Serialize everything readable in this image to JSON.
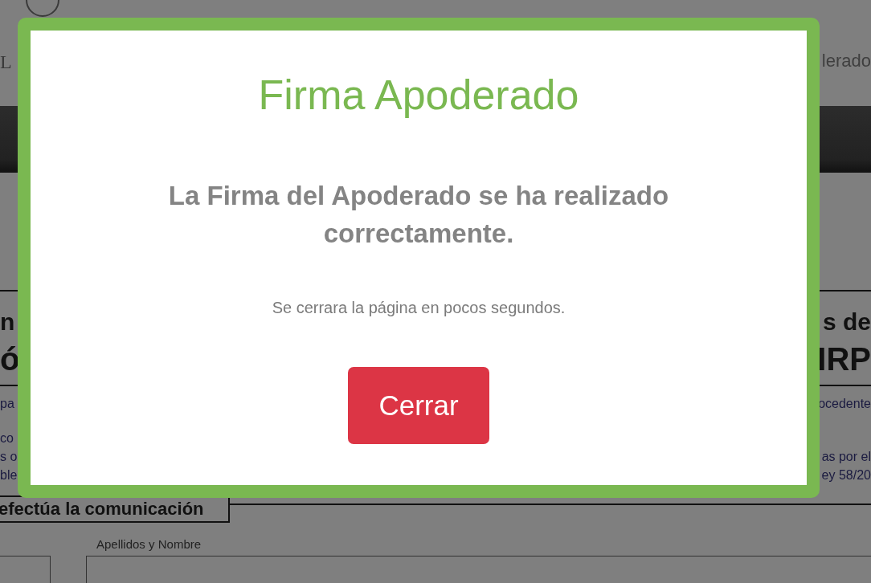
{
  "background": {
    "logo_letter": "L",
    "header_text": "lerado",
    "document_rows": [
      {
        "kind": "heading",
        "left": "n",
        "right": "s de"
      },
      {
        "kind": "title",
        "left": "ó",
        "right": "IRP"
      },
      {
        "kind": "body",
        "left": "pa",
        "right": "ocedente"
      },
      {
        "kind": "body",
        "left": "co"
      },
      {
        "kind": "body",
        "left": "s o",
        "right": "as por el"
      },
      {
        "kind": "body",
        "left": "ble",
        "right": "ey 58/20"
      }
    ],
    "section_heading": "efectúa la comunicación",
    "field_label": "Apellidos y Nombre"
  },
  "dialog": {
    "title": "Firma Apoderado",
    "message": "La Firma del Apoderado se ha realizado correctamente.",
    "note": "Se cerrara la página en pocos segundos.",
    "button": "Cerrar"
  }
}
